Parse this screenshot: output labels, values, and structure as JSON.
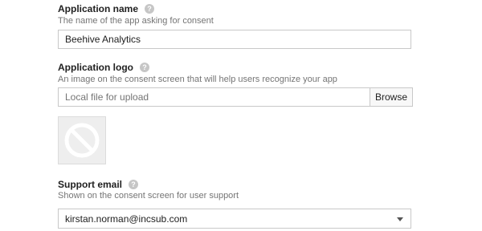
{
  "app_name": {
    "label": "Application name",
    "description": "The name of the app asking for consent",
    "value": "Beehive Analytics"
  },
  "app_logo": {
    "label": "Application logo",
    "description": "An image on the consent screen that will help users recognize your app",
    "placeholder": "Local file for upload",
    "browse_label": "Browse",
    "preview_icon": "no-image-icon"
  },
  "support_email": {
    "label": "Support email",
    "description": "Shown on the consent screen for user support",
    "value": "kirstan.norman@incsub.com"
  },
  "help_icon": "?",
  "colors": {
    "help_icon_bg": "#c6c6c6",
    "border": "#c8c8c8",
    "muted_text": "#757575"
  }
}
